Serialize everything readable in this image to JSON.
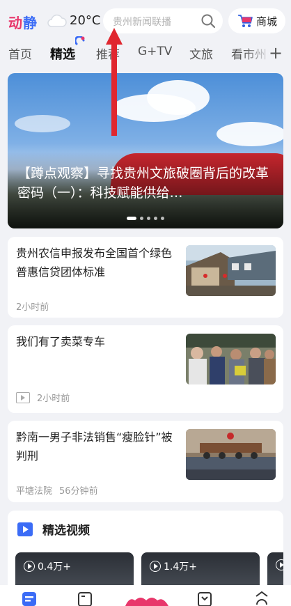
{
  "header": {
    "logo_part1": "动",
    "logo_part2": "静",
    "temperature": "20°C",
    "weather_icon": "cloud-icon",
    "search_placeholder": "贵州新闻联播",
    "mall_label": "商城"
  },
  "tabs": [
    {
      "label": "首页",
      "active": false
    },
    {
      "label": "精选",
      "active": true
    },
    {
      "label": "推荐",
      "active": false
    },
    {
      "label": "G+TV",
      "active": false
    },
    {
      "label": "文旅",
      "active": false
    },
    {
      "label": "看市州",
      "active": false
    }
  ],
  "banner": {
    "title": "【蹲点观察】寻找贵州文旅破圈背后的改革密码（一）：科技赋能供给…",
    "slide_count": 5,
    "active_slide": 1
  },
  "news": [
    {
      "title": "贵州农信申报发布全国首个绿色普惠信贷团体标准",
      "source": "",
      "time": "2小时前",
      "video": false
    },
    {
      "title": "我们有了卖菜专车",
      "source": "",
      "time": "2小时前",
      "video": true
    },
    {
      "title": "黔南一男子非法销售“瘦脸针”被判刑",
      "source": "平塘法院",
      "time": "56分钟前",
      "video": false
    }
  ],
  "videos_section": {
    "title": "精选视频",
    "items": [
      {
        "views": "0.4万+"
      },
      {
        "views": "1.4万+"
      }
    ]
  },
  "colors": {
    "accent": "#3b6cf6",
    "logo_red": "#e8376b",
    "annotation_arrow": "#e0272f"
  }
}
